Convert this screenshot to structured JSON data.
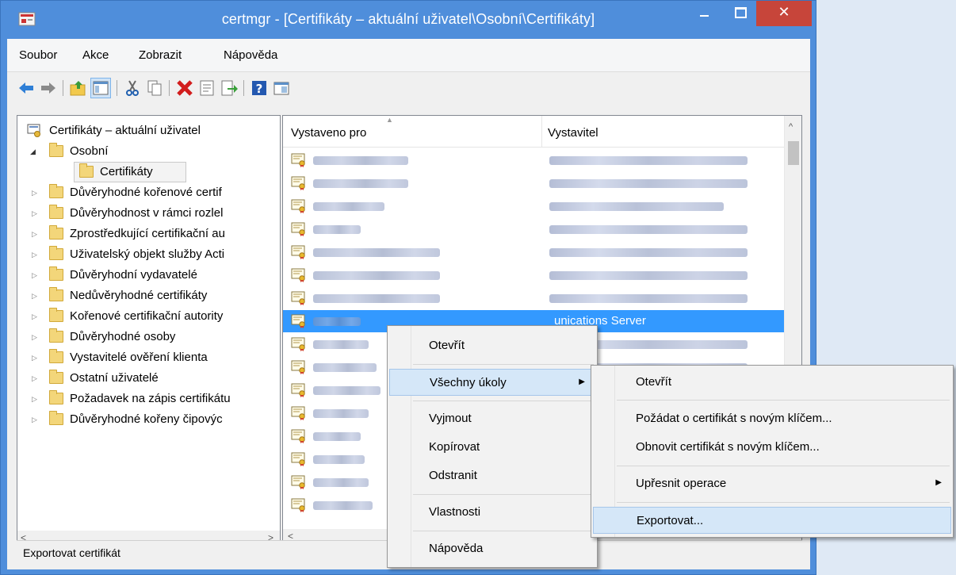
{
  "window": {
    "title": "certmgr - [Certifikáty – aktuální uživatel\\Osobní\\Certifikáty]",
    "close_glyph": "✕"
  },
  "menubar": [
    "Soubor",
    "Akce",
    "Zobrazit",
    "Nápověda"
  ],
  "toolbar": {
    "icons": [
      "back-arrow-icon",
      "forward-arrow-icon",
      "up-folder-icon",
      "show-hide-tree-icon",
      "cut-icon",
      "copy-icon",
      "delete-icon",
      "properties-icon",
      "export-list-icon",
      "help-icon",
      "console-tree-icon"
    ]
  },
  "tree": {
    "root": "Certifikáty – aktuální uživatel",
    "personal": "Osobní",
    "certificates": "Certifikáty",
    "items": [
      "Důvěryhodné kořenové certif",
      "Důvěryhodnost v rámci rozlel",
      "Zprostředkující certifikační au",
      "Uživatelský objekt služby Acti",
      "Důvěryhodní vydavatelé",
      "Nedůvěryhodné certifikáty",
      "Kořenové certifikační autority",
      "Důvěryhodné osoby",
      "Vystavitelé ověření klienta",
      "Ostatní uživatelé",
      "Požadavek na zápis certifikátu",
      "Důvěryhodné kořeny čipovýc"
    ]
  },
  "list": {
    "col_issued_to": "Vystaveno pro",
    "col_issuer": "Vystavitel",
    "selected_issuer": "Communications Server",
    "visible_issuer_partial": "unications Server"
  },
  "status": "Exportovat certifikát",
  "context_menu": {
    "open": "Otevřít",
    "all_tasks": "Všechny úkoly",
    "cut": "Vyjmout",
    "copy": "Kopírovat",
    "delete": "Odstranit",
    "properties": "Vlastnosti",
    "help": "Nápověda"
  },
  "submenu": {
    "open": "Otevřít",
    "request_new_key": "Požádat o certifikát s novým klíčem...",
    "renew_new_key": "Obnovit certifikát s novým klíčem...",
    "advanced": "Upřesnit operace",
    "export": "Exportovat..."
  },
  "colors": {
    "title_bar": "#4f8edb",
    "close_button": "#c7453a",
    "selection": "#3399ff",
    "menu_highlight": "#d5e7f8"
  }
}
